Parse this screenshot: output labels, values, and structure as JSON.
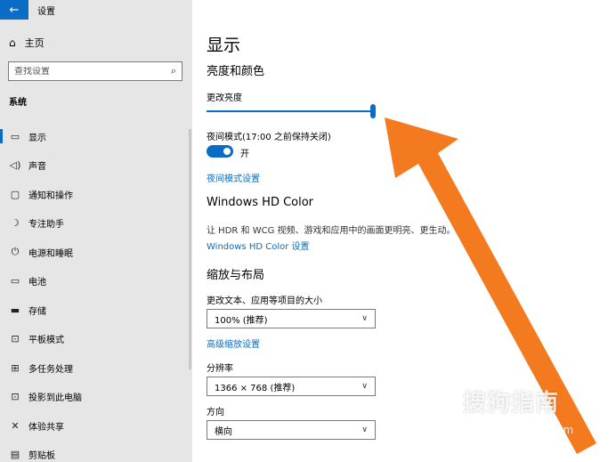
{
  "titlebar": {
    "back_icon": "←",
    "title": "设置"
  },
  "sidebar": {
    "home_label": "主页",
    "home_icon": "⌂",
    "search_placeholder": "查找设置",
    "search_icon": "⌕",
    "section": "系统",
    "items": [
      {
        "icon": "▭",
        "label": "显示",
        "active": true
      },
      {
        "icon": "◁)",
        "label": "声音"
      },
      {
        "icon": "▢",
        "label": "通知和操作"
      },
      {
        "icon": "☽",
        "label": "专注助手"
      },
      {
        "icon": "⏻",
        "label": "电源和睡眠"
      },
      {
        "icon": "▭",
        "label": "电池"
      },
      {
        "icon": "▬",
        "label": "存储"
      },
      {
        "icon": "⊡",
        "label": "平板模式"
      },
      {
        "icon": "⊞",
        "label": "多任务处理"
      },
      {
        "icon": "⊡",
        "label": "投影到此电脑"
      },
      {
        "icon": "✕",
        "label": "体验共享"
      },
      {
        "icon": "▤",
        "label": "剪贴板"
      }
    ]
  },
  "main": {
    "title": "显示",
    "brightness_heading": "亮度和颜色",
    "change_brightness": "更改亮度",
    "brightness_level": 1.0,
    "night_mode_label": "夜间模式(17:00 之前保持关闭)",
    "night_toggle_state": "开",
    "night_settings_link": "夜间模式设置",
    "hd_heading": "Windows HD Color",
    "hd_desc": "让 HDR 和 WCG 视频、游戏和应用中的画面更明亮、更生动。",
    "hd_link": "Windows HD Color 设置",
    "scale_heading": "缩放与布局",
    "scale_label": "更改文本、应用等项目的大小",
    "scale_value": "100% (推荐)",
    "advanced_scale_link": "高级缩放设置",
    "resolution_label": "分辨率",
    "resolution_value": "1366 × 768 (推荐)",
    "orientation_label": "方向",
    "orientation_value": "横向",
    "chevron": "∨"
  },
  "watermark": {
    "text": "搜狗指南",
    "url": "zhinan.sogou.com"
  },
  "colors": {
    "accent": "#0a6cc4",
    "arrow": "#f47a20",
    "sidebar_bg": "#e6e6e6"
  }
}
